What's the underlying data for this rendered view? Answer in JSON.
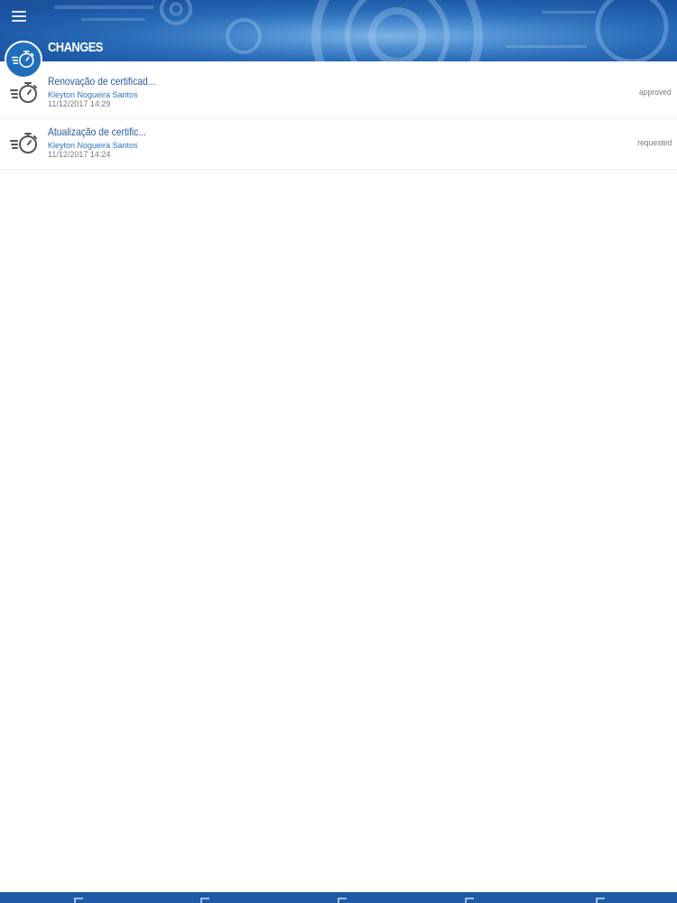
{
  "header": {
    "title": "CHANGES",
    "menu_icon": "hamburger-menu-icon",
    "badge_icon": "stopwatch-icon",
    "color": "#1c58a6"
  },
  "changes": [
    {
      "title": "Renovação de certificad...",
      "author": "Kleyton Nogueira Santos",
      "date": "11/12/2017 14:29",
      "status": "approved",
      "icon": "stopwatch-icon"
    },
    {
      "title": "Atualização de certific...",
      "author": "Kleyton Nogueira Santos",
      "date": "11/12/2017 14:24",
      "status": "requested",
      "icon": "stopwatch-icon"
    }
  ],
  "colors": {
    "title_text": "#2a5a9a",
    "author_text": "#2f73c0",
    "bottom_bar": "#1f5aa6"
  }
}
